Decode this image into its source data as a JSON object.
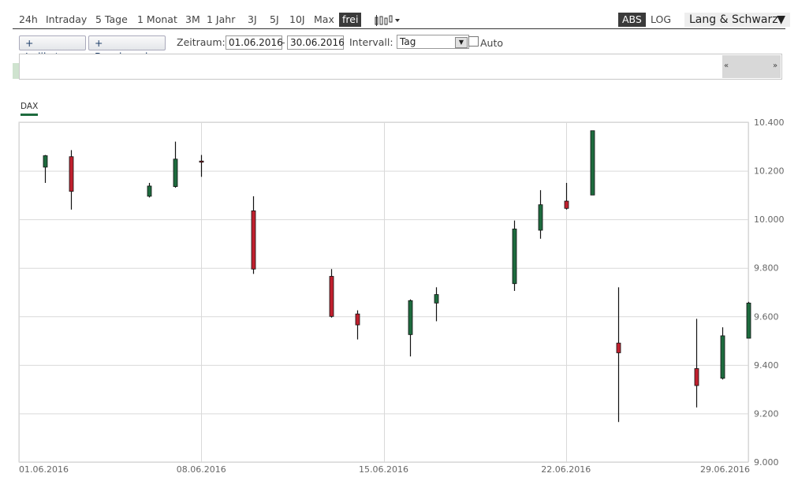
{
  "range_buttons": [
    "24h",
    "Intraday",
    "5 Tage",
    "1 Monat",
    "3M",
    "1 Jahr",
    "3J",
    "5J",
    "10J",
    "Max",
    "frei"
  ],
  "active_range": "frei",
  "scale_buttons": [
    "ABS",
    "LOG"
  ],
  "active_scale": "ABS",
  "provider": "Lang & Schwarz",
  "toolbar": {
    "indicator_label": "+ Indikator",
    "benchmark_label": "+ Benchmark",
    "zeitraum_label": "Zeitraum:",
    "date_from": "01.06.2016",
    "date_separator": "-",
    "date_to": "30.06.2016",
    "interval_label": "Intervall:",
    "interval_value": "Tag",
    "auto_label": "Auto",
    "auto_checked": false
  },
  "navigator": {
    "left_arrow": "«",
    "right_arrow": "»"
  },
  "legend": {
    "label": "DAX",
    "color": "#1e6b3e"
  },
  "colors": {
    "up": "#1e6b3e",
    "down": "#c0202e",
    "grid": "#d9d9d9",
    "active_button": "#3a3a3a"
  },
  "chart_data": {
    "type": "candlestick",
    "series_name": "DAX",
    "ylim": [
      9000,
      10400
    ],
    "y_ticks": [
      "10.400",
      "10.200",
      "10.000",
      "9.800",
      "9.600",
      "9.400",
      "9.200",
      "9.000"
    ],
    "y_tick_values": [
      10400,
      10200,
      10000,
      9800,
      9600,
      9400,
      9200,
      9000
    ],
    "x_ticks": [
      "01.06.2016",
      "08.06.2016",
      "15.06.2016",
      "22.06.2016",
      "29.06.2016"
    ],
    "grid": true,
    "candles": [
      {
        "date": "02.06.2016",
        "open": 10215,
        "high": 10265,
        "low": 10150,
        "close": 10262
      },
      {
        "date": "03.06.2016",
        "open": 10258,
        "high": 10285,
        "low": 10040,
        "close": 10115
      },
      {
        "date": "06.06.2016",
        "open": 10095,
        "high": 10150,
        "low": 10090,
        "close": 10137
      },
      {
        "date": "07.06.2016",
        "open": 10135,
        "high": 10320,
        "low": 10130,
        "close": 10248
      },
      {
        "date": "08.06.2016",
        "open": 10240,
        "high": 10265,
        "low": 10175,
        "close": 10237
      },
      {
        "date": "10.06.2016",
        "open": 10035,
        "high": 10095,
        "low": 9775,
        "close": 9795
      },
      {
        "date": "13.06.2016",
        "open": 9765,
        "high": 9795,
        "low": 9595,
        "close": 9600
      },
      {
        "date": "14.06.2016",
        "open": 9610,
        "high": 9625,
        "low": 9505,
        "close": 9565
      },
      {
        "date": "16.06.2016",
        "open": 9525,
        "high": 9670,
        "low": 9435,
        "close": 9665
      },
      {
        "date": "17.06.2016",
        "open": 9655,
        "high": 9720,
        "low": 9580,
        "close": 9690
      },
      {
        "date": "20.06.2016",
        "open": 9735,
        "high": 9995,
        "low": 9705,
        "close": 9960
      },
      {
        "date": "21.06.2016",
        "open": 9955,
        "high": 10120,
        "low": 9920,
        "close": 10060
      },
      {
        "date": "22.06.2016",
        "open": 10075,
        "high": 10150,
        "low": 10040,
        "close": 10045
      },
      {
        "date": "23.06.2016",
        "open": 10100,
        "high": 10365,
        "low": 10100,
        "close": 10365
      },
      {
        "date": "24.06.2016",
        "open": 9490,
        "high": 9720,
        "low": 9165,
        "close": 9450
      },
      {
        "date": "27.06.2016",
        "open": 9385,
        "high": 9590,
        "low": 9225,
        "close": 9315
      },
      {
        "date": "28.06.2016",
        "open": 9345,
        "high": 9555,
        "low": 9340,
        "close": 9520
      },
      {
        "date": "29.06.2016",
        "open": 9510,
        "high": 9660,
        "low": 9510,
        "close": 9655
      }
    ]
  }
}
